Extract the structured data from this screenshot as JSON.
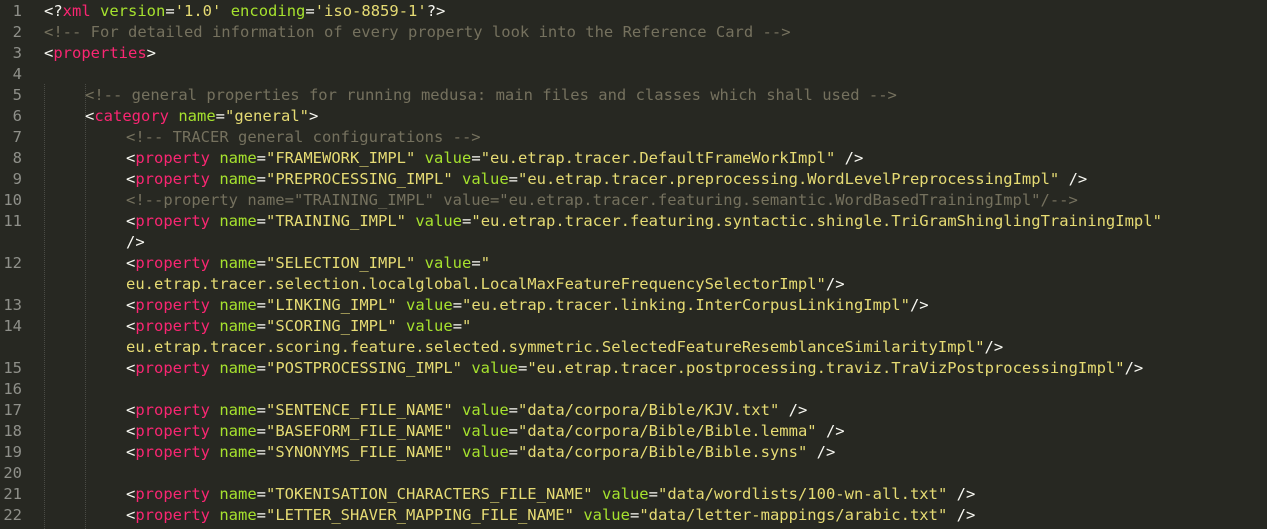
{
  "editor": {
    "theme_colors": {
      "background": "#272822",
      "line_number": "#8f908a",
      "tag": "#f92672",
      "attribute": "#a6e22e",
      "string": "#e6db74",
      "comment": "#75715e",
      "text": "#f8f8f2"
    },
    "rows": [
      {
        "ln": "1",
        "indent": 0,
        "tokens": [
          [
            "p",
            "<?"
          ],
          [
            "k",
            "xml"
          ],
          [
            "p",
            " "
          ],
          [
            "a",
            "version"
          ],
          [
            "p",
            "="
          ],
          [
            "s",
            "'1.0'"
          ],
          [
            "p",
            " "
          ],
          [
            "a",
            "encoding"
          ],
          [
            "p",
            "="
          ],
          [
            "s",
            "'iso-8859-1'"
          ],
          [
            "p",
            "?>"
          ]
        ]
      },
      {
        "ln": "2",
        "indent": 0,
        "tokens": [
          [
            "c",
            "<!-- For detailed information of every property look into the Reference Card -->"
          ]
        ]
      },
      {
        "ln": "3",
        "indent": 0,
        "tokens": [
          [
            "p",
            "<"
          ],
          [
            "k",
            "properties"
          ],
          [
            "p",
            ">"
          ]
        ]
      },
      {
        "ln": "4",
        "indent": 0,
        "tokens": []
      },
      {
        "ln": "5",
        "indent": 1,
        "tokens": [
          [
            "c",
            "<!-- general properties for running medusa: main files and classes which shall used -->"
          ]
        ]
      },
      {
        "ln": "6",
        "indent": 1,
        "tokens": [
          [
            "p",
            "<"
          ],
          [
            "k",
            "category"
          ],
          [
            "p",
            " "
          ],
          [
            "a",
            "name"
          ],
          [
            "p",
            "="
          ],
          [
            "s",
            "\"general\""
          ],
          [
            "p",
            ">"
          ]
        ]
      },
      {
        "ln": "7",
        "indent": 2,
        "tokens": [
          [
            "c",
            "<!-- TRACER general configurations -->"
          ]
        ]
      },
      {
        "ln": "8",
        "indent": 2,
        "tokens": [
          [
            "p",
            "<"
          ],
          [
            "k",
            "property"
          ],
          [
            "p",
            " "
          ],
          [
            "a",
            "name"
          ],
          [
            "p",
            "="
          ],
          [
            "s",
            "\"FRAMEWORK_IMPL\""
          ],
          [
            "p",
            " "
          ],
          [
            "a",
            "value"
          ],
          [
            "p",
            "="
          ],
          [
            "s",
            "\"eu.etrap.tracer.DefaultFrameWorkImpl\""
          ],
          [
            "p",
            " />"
          ]
        ]
      },
      {
        "ln": "9",
        "indent": 2,
        "tokens": [
          [
            "p",
            "<"
          ],
          [
            "k",
            "property"
          ],
          [
            "p",
            " "
          ],
          [
            "a",
            "name"
          ],
          [
            "p",
            "="
          ],
          [
            "s",
            "\"PREPROCESSING_IMPL\""
          ],
          [
            "p",
            " "
          ],
          [
            "a",
            "value"
          ],
          [
            "p",
            "="
          ],
          [
            "s",
            "\"eu.etrap.tracer.preprocessing.WordLevelPreprocessingImpl\""
          ],
          [
            "p",
            " />"
          ]
        ]
      },
      {
        "ln": "10",
        "indent": 2,
        "tokens": [
          [
            "c",
            "<!--property name=\"TRAINING_IMPL\" value=\"eu.etrap.tracer.featuring.semantic.WordBasedTrainingImpl\"/-->"
          ]
        ]
      },
      {
        "ln": "11",
        "indent": 2,
        "tokens": [
          [
            "p",
            "<"
          ],
          [
            "k",
            "property"
          ],
          [
            "p",
            " "
          ],
          [
            "a",
            "name"
          ],
          [
            "p",
            "="
          ],
          [
            "s",
            "\"TRAINING_IMPL\""
          ],
          [
            "p",
            " "
          ],
          [
            "a",
            "value"
          ],
          [
            "p",
            "="
          ],
          [
            "s",
            "\"eu.etrap.tracer.featuring.syntactic.shingle.TriGramShinglingTrainingImpl\""
          ]
        ]
      },
      {
        "ln": "",
        "indent": 2,
        "tokens": [
          [
            "p",
            "/>"
          ]
        ]
      },
      {
        "ln": "12",
        "indent": 2,
        "tokens": [
          [
            "p",
            "<"
          ],
          [
            "k",
            "property"
          ],
          [
            "p",
            " "
          ],
          [
            "a",
            "name"
          ],
          [
            "p",
            "="
          ],
          [
            "s",
            "\"SELECTION_IMPL\""
          ],
          [
            "p",
            " "
          ],
          [
            "a",
            "value"
          ],
          [
            "p",
            "="
          ],
          [
            "s",
            "\""
          ]
        ]
      },
      {
        "ln": "",
        "indent": 2,
        "tokens": [
          [
            "s",
            "eu.etrap.tracer.selection.localglobal.LocalMaxFeatureFrequencySelectorImpl\""
          ],
          [
            "p",
            "/>"
          ]
        ]
      },
      {
        "ln": "13",
        "indent": 2,
        "tokens": [
          [
            "p",
            "<"
          ],
          [
            "k",
            "property"
          ],
          [
            "p",
            " "
          ],
          [
            "a",
            "name"
          ],
          [
            "p",
            "="
          ],
          [
            "s",
            "\"LINKING_IMPL\""
          ],
          [
            "p",
            " "
          ],
          [
            "a",
            "value"
          ],
          [
            "p",
            "="
          ],
          [
            "s",
            "\"eu.etrap.tracer.linking.InterCorpusLinkingImpl\""
          ],
          [
            "p",
            "/>"
          ]
        ]
      },
      {
        "ln": "14",
        "indent": 2,
        "tokens": [
          [
            "p",
            "<"
          ],
          [
            "k",
            "property"
          ],
          [
            "p",
            " "
          ],
          [
            "a",
            "name"
          ],
          [
            "p",
            "="
          ],
          [
            "s",
            "\"SCORING_IMPL\""
          ],
          [
            "p",
            " "
          ],
          [
            "a",
            "value"
          ],
          [
            "p",
            "="
          ],
          [
            "s",
            "\""
          ]
        ]
      },
      {
        "ln": "",
        "indent": 2,
        "tokens": [
          [
            "s",
            "eu.etrap.tracer.scoring.feature.selected.symmetric.SelectedFeatureResemblanceSimilarityImpl\""
          ],
          [
            "p",
            "/>"
          ]
        ]
      },
      {
        "ln": "15",
        "indent": 2,
        "tokens": [
          [
            "p",
            "<"
          ],
          [
            "k",
            "property"
          ],
          [
            "p",
            " "
          ],
          [
            "a",
            "name"
          ],
          [
            "p",
            "="
          ],
          [
            "s",
            "\"POSTPROCESSING_IMPL\""
          ],
          [
            "p",
            " "
          ],
          [
            "a",
            "value"
          ],
          [
            "p",
            "="
          ],
          [
            "s",
            "\"eu.etrap.tracer.postprocessing.traviz.TraVizPostprocessingImpl\""
          ],
          [
            "p",
            "/>"
          ]
        ]
      },
      {
        "ln": "16",
        "indent": 2,
        "tokens": []
      },
      {
        "ln": "17",
        "indent": 2,
        "tokens": [
          [
            "p",
            "<"
          ],
          [
            "k",
            "property"
          ],
          [
            "p",
            " "
          ],
          [
            "a",
            "name"
          ],
          [
            "p",
            "="
          ],
          [
            "s",
            "\"SENTENCE_FILE_NAME\""
          ],
          [
            "p",
            " "
          ],
          [
            "a",
            "value"
          ],
          [
            "p",
            "="
          ],
          [
            "s",
            "\"data/corpora/Bible/KJV.txt\""
          ],
          [
            "p",
            " />"
          ]
        ]
      },
      {
        "ln": "18",
        "indent": 2,
        "tokens": [
          [
            "p",
            "<"
          ],
          [
            "k",
            "property"
          ],
          [
            "p",
            " "
          ],
          [
            "a",
            "name"
          ],
          [
            "p",
            "="
          ],
          [
            "s",
            "\"BASEFORM_FILE_NAME\""
          ],
          [
            "p",
            " "
          ],
          [
            "a",
            "value"
          ],
          [
            "p",
            "="
          ],
          [
            "s",
            "\"data/corpora/Bible/Bible.lemma\""
          ],
          [
            "p",
            " />"
          ]
        ]
      },
      {
        "ln": "19",
        "indent": 2,
        "tokens": [
          [
            "p",
            "<"
          ],
          [
            "k",
            "property"
          ],
          [
            "p",
            " "
          ],
          [
            "a",
            "name"
          ],
          [
            "p",
            "="
          ],
          [
            "s",
            "\"SYNONYMS_FILE_NAME\""
          ],
          [
            "p",
            " "
          ],
          [
            "a",
            "value"
          ],
          [
            "p",
            "="
          ],
          [
            "s",
            "\"data/corpora/Bible/Bible.syns\""
          ],
          [
            "p",
            " />"
          ]
        ]
      },
      {
        "ln": "20",
        "indent": 2,
        "tokens": []
      },
      {
        "ln": "21",
        "indent": 2,
        "tokens": [
          [
            "p",
            "<"
          ],
          [
            "k",
            "property"
          ],
          [
            "p",
            " "
          ],
          [
            "a",
            "name"
          ],
          [
            "p",
            "="
          ],
          [
            "s",
            "\"TOKENISATION_CHARACTERS_FILE_NAME\""
          ],
          [
            "p",
            " "
          ],
          [
            "a",
            "value"
          ],
          [
            "p",
            "="
          ],
          [
            "s",
            "\"data/wordlists/100-wn-all.txt\""
          ],
          [
            "p",
            " />"
          ]
        ]
      },
      {
        "ln": "22",
        "indent": 2,
        "tokens": [
          [
            "p",
            "<"
          ],
          [
            "k",
            "property"
          ],
          [
            "p",
            " "
          ],
          [
            "a",
            "name"
          ],
          [
            "p",
            "="
          ],
          [
            "s",
            "\"LETTER_SHAVER_MAPPING_FILE_NAME\""
          ],
          [
            "p",
            " "
          ],
          [
            "a",
            "value"
          ],
          [
            "p",
            "="
          ],
          [
            "s",
            "\"data/letter-mappings/arabic.txt\""
          ],
          [
            "p",
            " />"
          ]
        ]
      }
    ]
  }
}
